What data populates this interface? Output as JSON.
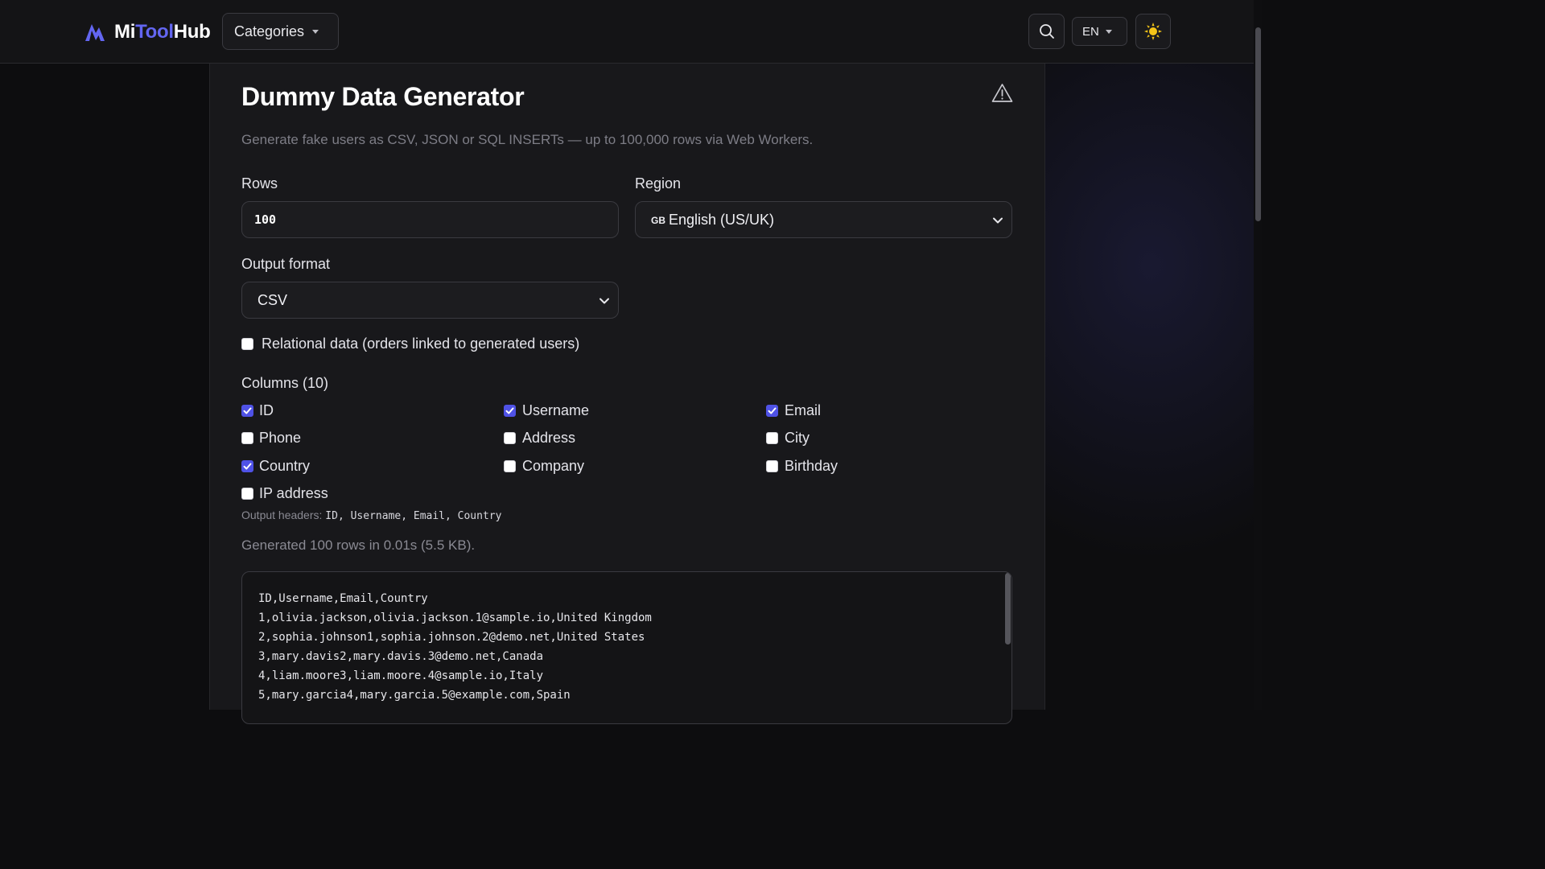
{
  "header": {
    "logo": {
      "part1": "Mi",
      "part2": "Tool",
      "part3": "Hub"
    },
    "categories_label": "Categories",
    "language_label": "EN"
  },
  "tool": {
    "title": "Dummy Data Generator",
    "subtitle": "Generate fake users as CSV, JSON or SQL INSERTs — up to 100,000 rows via Web Workers."
  },
  "form": {
    "rows_label": "Rows",
    "rows_value": "100",
    "region_label": "Region",
    "region_flag": "GB",
    "region_value": "English (US/UK)",
    "format_label": "Output format",
    "format_value": "CSV",
    "relational_label": "Relational data (orders linked to generated users)",
    "relational_checked": false
  },
  "columns": {
    "heading": "Columns (10)",
    "items": [
      {
        "label": "ID",
        "checked": true
      },
      {
        "label": "Username",
        "checked": true
      },
      {
        "label": "Email",
        "checked": true
      },
      {
        "label": "Phone",
        "checked": false
      },
      {
        "label": "Address",
        "checked": false
      },
      {
        "label": "City",
        "checked": false
      },
      {
        "label": "Country",
        "checked": true
      },
      {
        "label": "Company",
        "checked": false
      },
      {
        "label": "Birthday",
        "checked": false
      },
      {
        "label": "IP address",
        "checked": false
      }
    ]
  },
  "output": {
    "headers_prefix": "Output headers:",
    "headers_value": "ID, Username, Email, Country",
    "status": "Generated 100 rows in 0.01s (5.5 KB).",
    "lines": [
      "ID,Username,Email,Country",
      "1,olivia.jackson,olivia.jackson.1@sample.io,United Kingdom",
      "2,sophia.johnson1,sophia.johnson.2@demo.net,United States",
      "3,mary.davis2,mary.davis.3@demo.net,Canada",
      "4,liam.moore3,liam.moore.4@sample.io,Italy",
      "5,mary.garcia4,mary.garcia.5@example.com,Spain"
    ]
  },
  "colors": {
    "accent": "#6366f1",
    "checkbox_checked": "#4f52e6",
    "background": "#0d0d0f",
    "card": "#18181b",
    "sun": "#f5c518"
  }
}
